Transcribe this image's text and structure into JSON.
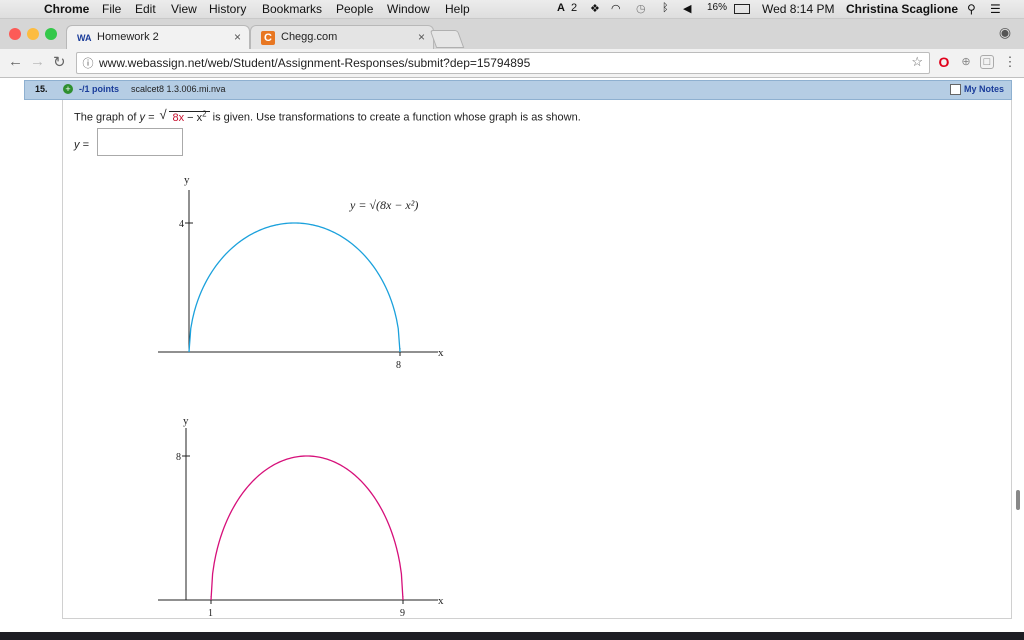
{
  "menubar": {
    "app": "Chrome",
    "items": [
      "File",
      "Edit",
      "View",
      "History",
      "Bookmarks",
      "People",
      "Window",
      "Help"
    ],
    "adobe_count": "2",
    "battery": "16%",
    "clock": "Wed 8:14 PM",
    "user": "Christina Scaglione"
  },
  "tabs": [
    {
      "title": "Homework 2",
      "favicon": "webassign-icon",
      "close": "×"
    },
    {
      "title": "Chegg.com",
      "favicon": "chegg-icon",
      "close": "×"
    }
  ],
  "toolbar": {
    "url": "www.webassign.net/web/Student/Assignment-Responses/submit?dep=15794895"
  },
  "question": {
    "number": "15.",
    "points": "-/1 points",
    "code": "scalcet8 1.3.006.mi.nva",
    "my_notes": "My Notes",
    "prompt_pre": "The graph of",
    "prompt_eq_lhs": "y =",
    "prompt_rad_8x": "8x",
    "prompt_rad_rest": " − x",
    "prompt_sup": "2",
    "prompt_post": "is given. Use transformations to create a function whose graph is as shown.",
    "answer_label": "y =",
    "answer_value": ""
  },
  "chart_data": [
    {
      "type": "line",
      "title": "",
      "equation_label": "y = √(8x − x²)",
      "xlabel": "x",
      "ylabel": "y",
      "x_ticks": [
        "8"
      ],
      "y_ticks": [
        "4"
      ],
      "xlim": [
        0,
        8
      ],
      "ylim": [
        0,
        4
      ],
      "color": "#1ba1dc",
      "curve": "semicircle",
      "center_x": 4,
      "radius": 4
    },
    {
      "type": "line",
      "title": "",
      "xlabel": "x",
      "ylabel": "y",
      "x_ticks": [
        "1",
        "9"
      ],
      "y_ticks": [
        "8"
      ],
      "xlim": [
        1,
        9
      ],
      "ylim": [
        0,
        8
      ],
      "color": "#d6107a",
      "curve": "stretched-semicircle",
      "center_x": 5,
      "radius": 4,
      "peak": 8
    }
  ],
  "colors": {
    "question_bar": "#b5cde4",
    "link_blue": "#1a3c9a",
    "graph1": "#1ba1dc",
    "graph2": "#d6107a"
  }
}
